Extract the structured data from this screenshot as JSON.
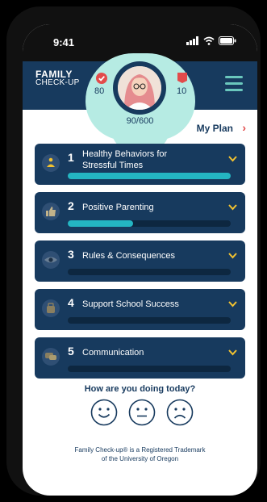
{
  "status": {
    "time": "9:41"
  },
  "logo": {
    "line1": "FAMILY",
    "line2": "CHECK-UP"
  },
  "stats": {
    "checks": "80",
    "flags": "10",
    "score": "90/600"
  },
  "my_plan": {
    "label": "My Plan"
  },
  "modules": [
    {
      "number": "1",
      "title": "Healthy Behaviors for Stressful Times",
      "progress": 1.0,
      "icon": "meditation-icon"
    },
    {
      "number": "2",
      "title": "Positive Parenting",
      "progress": 0.4,
      "icon": "thumbs-up-icon"
    },
    {
      "number": "3",
      "title": "Rules & Consequences",
      "progress": 0.0,
      "icon": "eye-icon"
    },
    {
      "number": "4",
      "title": "Support School Success",
      "progress": 0.0,
      "icon": "school-bag-icon"
    },
    {
      "number": "5",
      "title": "Communication",
      "progress": 0.0,
      "icon": "speech-bubble-icon"
    }
  ],
  "mood": {
    "question": "How are you doing today?",
    "options": [
      "happy-face-icon",
      "neutral-face-icon",
      "sad-face-icon"
    ]
  },
  "footer": {
    "line1": "Family Check-up® is a Registered Trademark",
    "line2": "of the University of Oregon"
  },
  "colors": {
    "navy": "#173a5e",
    "teal_light": "#b6ebe3",
    "progress": "#24b5c2",
    "chevron": "#f2c230",
    "badge_red": "#e24b4b"
  }
}
